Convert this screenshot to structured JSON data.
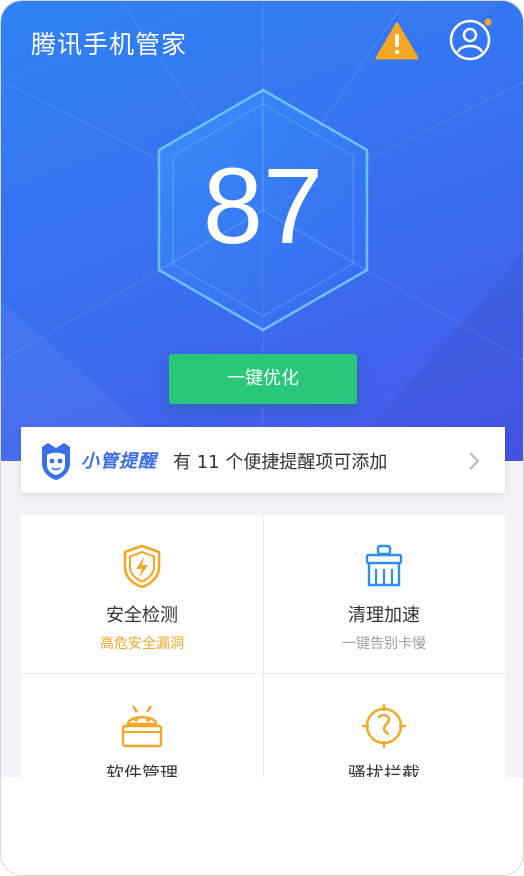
{
  "app": {
    "title": "腾讯手机管家"
  },
  "header": {
    "warning_icon": "warning-triangle-icon",
    "user_icon": "user-avatar-icon",
    "notification_dot_color": "#f5a623"
  },
  "score": {
    "value": "87"
  },
  "optimize_button": {
    "label": "一键优化"
  },
  "reminder": {
    "badge": "小管提醒",
    "text": "有 11 个便捷提醒项可添加"
  },
  "features": [
    {
      "title": "安全检测",
      "subtitle": "高危安全漏洞",
      "icon": "shield-lightning-icon",
      "subtitle_color": "#f5a623"
    },
    {
      "title": "清理加速",
      "subtitle": "一键告别卡慢",
      "icon": "broom-icon",
      "subtitle_color": "#a0a0a0"
    },
    {
      "title": "软件管理",
      "subtitle": "",
      "icon": "android-box-icon"
    },
    {
      "title": "骚扰拦截",
      "subtitle": "",
      "icon": "phone-block-icon"
    }
  ],
  "colors": {
    "hero_start": "#2f82f4",
    "hero_end": "#4a57ea",
    "accent_green": "#28c77a",
    "accent_orange": "#f5a623",
    "accent_blue": "#3b6fe8"
  }
}
